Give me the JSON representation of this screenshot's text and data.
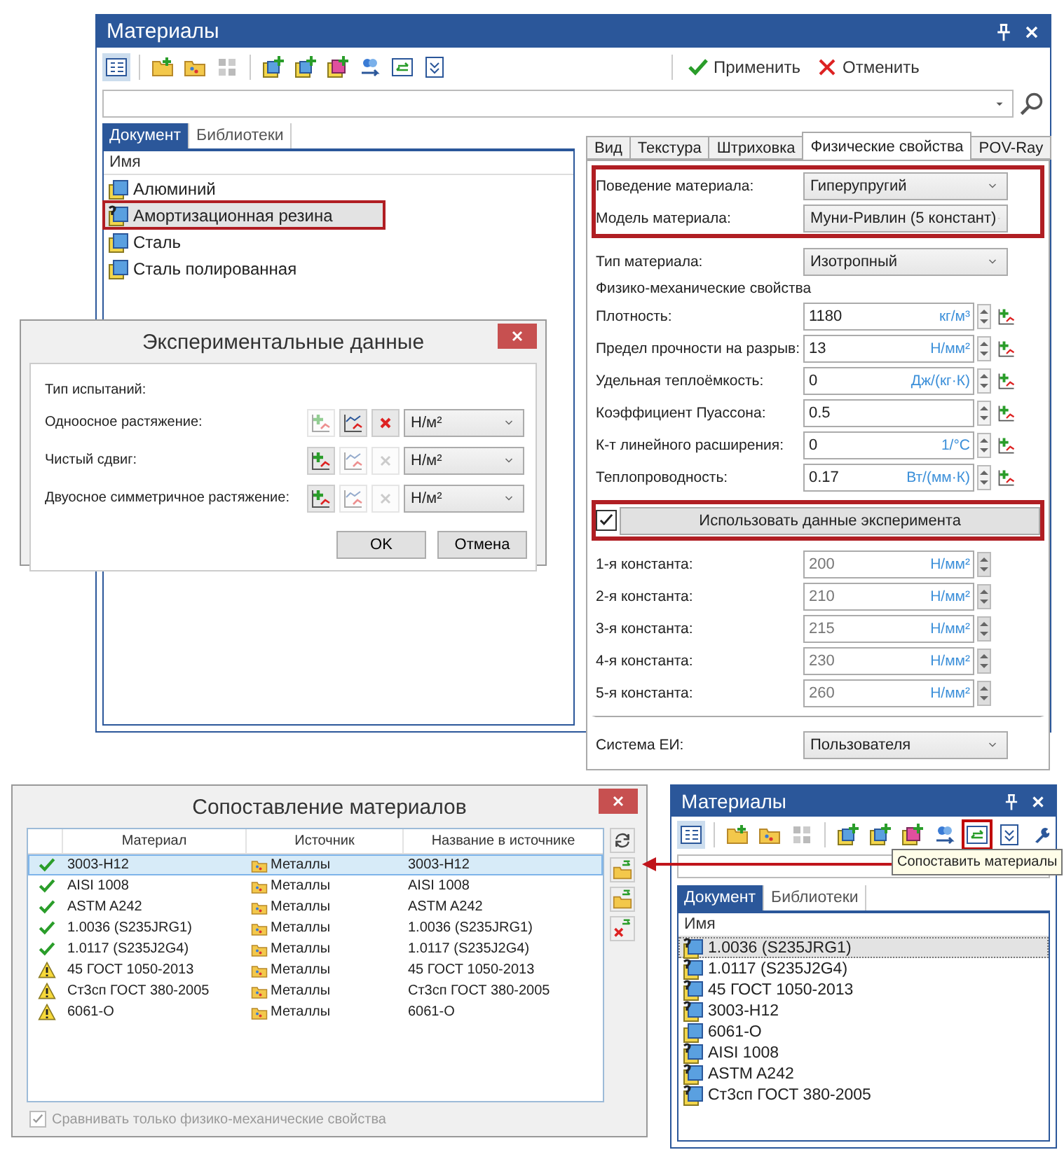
{
  "main_window": {
    "title": "Материалы",
    "apply": "Применить",
    "cancel": "Отменить",
    "library_tabs": [
      {
        "label": "Документ",
        "selected": true
      },
      {
        "label": "Библиотеки",
        "selected": false
      }
    ],
    "list_header": "Имя",
    "materials": [
      {
        "name": "Алюминий",
        "kind": "defined",
        "selected": false,
        "highlighted": false
      },
      {
        "name": "Амортизационная резина",
        "kind": "undefined",
        "selected": true,
        "highlighted": true
      },
      {
        "name": "Сталь",
        "kind": "defined",
        "selected": false,
        "highlighted": false
      },
      {
        "name": "Сталь полированная",
        "kind": "defined",
        "selected": false,
        "highlighted": false
      }
    ],
    "property_tabs": [
      {
        "label": "Вид",
        "selected": false
      },
      {
        "label": "Текстура",
        "selected": false
      },
      {
        "label": "Штриховка",
        "selected": false
      },
      {
        "label": "Физические свойства",
        "selected": true
      },
      {
        "label": "POV-Ray",
        "selected": false
      }
    ],
    "property_sections": [
      {
        "highlighted": true,
        "divided": false,
        "rows": [
          {
            "kind": "select",
            "label": "Поведение материала:",
            "value": "Гиперупругий"
          },
          {
            "kind": "select",
            "label": "Модель материала:",
            "value": "Муни-Ривлин (5 констант)"
          }
        ]
      },
      {
        "highlighted": false,
        "divided": false,
        "rows": [
          {
            "kind": "select",
            "label": "Тип материала:",
            "value": "Изотропный"
          },
          {
            "kind": "heading",
            "label": "Физико-механические свойства"
          },
          {
            "kind": "number",
            "label": "Плотность:",
            "value": "1180",
            "unit": "кг/м³"
          },
          {
            "kind": "number",
            "label": "Предел прочности на разрыв:",
            "value": "13",
            "unit": "Н/мм²"
          },
          {
            "kind": "number",
            "label": "Удельная теплоёмкость:",
            "value": "0",
            "unit": "Дж/(кг·К)"
          },
          {
            "kind": "number",
            "label": "Коэффициент Пуассона:",
            "value": "0.5"
          },
          {
            "kind": "number",
            "label": "К-т линейного расширения:",
            "value": "0",
            "unit": "1/°C"
          },
          {
            "kind": "number",
            "label": "Теплопроводность:",
            "value": "0.17",
            "unit": "Вт/(мм·К)"
          }
        ]
      },
      {
        "highlighted": true,
        "divided": false,
        "rows": [
          {
            "kind": "checkbox_button",
            "label": "Использовать данные эксперимента",
            "checked": true
          }
        ]
      },
      {
        "highlighted": false,
        "divided": false,
        "rows": [
          {
            "kind": "constant",
            "label": "1-я константа:",
            "value": "200",
            "unit": "Н/мм²"
          },
          {
            "kind": "constant",
            "label": "2-я константа:",
            "value": "210",
            "unit": "Н/мм²"
          },
          {
            "kind": "constant",
            "label": "3-я константа:",
            "value": "215",
            "unit": "Н/мм²"
          },
          {
            "kind": "constant",
            "label": "4-я константа:",
            "value": "230",
            "unit": "Н/мм²"
          },
          {
            "kind": "constant",
            "label": "5-я константа:",
            "value": "260",
            "unit": "Н/мм²"
          }
        ]
      },
      {
        "highlighted": false,
        "divided": true,
        "rows": [
          {
            "kind": "select",
            "label": "Система ЕИ:",
            "value": "Пользователя"
          }
        ]
      }
    ]
  },
  "experiment_dialog": {
    "title": "Экспериментальные данные",
    "subtitle": "Тип испытаний:",
    "tests": [
      {
        "label": "Одноосное растяжение:",
        "has_data": true,
        "unit": "Н/м²"
      },
      {
        "label": "Чистый сдвиг:",
        "has_data": false,
        "unit": "Н/м²"
      },
      {
        "label": "Двуосное симметричное растяжение:",
        "has_data": false,
        "unit": "Н/м²"
      }
    ],
    "buttons": [
      "OK",
      "Отмена"
    ]
  },
  "compare_dialog": {
    "title": "Сопоставление материалов",
    "columns": [
      "Материал",
      "Источник",
      "Название в источнике"
    ],
    "rows": [
      {
        "kind": "ok",
        "material": "3003-H12",
        "source": "Металлы",
        "source_name": "3003-H12",
        "selected": true
      },
      {
        "kind": "ok",
        "material": "AISI 1008",
        "source": "Металлы",
        "source_name": "AISI 1008",
        "selected": false
      },
      {
        "kind": "ok",
        "material": "ASTM A242",
        "source": "Металлы",
        "source_name": "ASTM A242",
        "selected": false
      },
      {
        "kind": "ok",
        "material": "1.0036 (S235JRG1)",
        "source": "Металлы",
        "source_name": "1.0036 (S235JRG1)",
        "selected": false
      },
      {
        "kind": "ok",
        "material": "1.0117 (S235J2G4)",
        "source": "Металлы",
        "source_name": "1.0117 (S235J2G4)",
        "selected": false
      },
      {
        "kind": "warning",
        "material": "45 ГОСТ 1050-2013",
        "source": "Металлы",
        "source_name": "45 ГОСТ 1050-2013",
        "selected": false
      },
      {
        "kind": "warning",
        "material": "Ст3сп ГОСТ 380-2005",
        "source": "Металлы",
        "source_name": "Ст3сп ГОСТ 380-2005",
        "selected": false
      },
      {
        "kind": "warning",
        "material": "6061-O",
        "source": "Металлы",
        "source_name": "6061-O",
        "selected": false
      }
    ],
    "footer": {
      "label": "Сравнивать только физико-механические свойства",
      "checked": true
    }
  },
  "small_window": {
    "title": "Материалы",
    "tooltip": "Сопоставить материалы",
    "library_tabs": [
      {
        "label": "Документ",
        "selected": true
      },
      {
        "label": "Библиотеки",
        "selected": false
      }
    ],
    "list_header": "Имя",
    "materials": [
      {
        "name": "1.0036 (S235JRG1)",
        "kind": "undefined",
        "selected": true
      },
      {
        "name": "1.0117 (S235J2G4)",
        "kind": "undefined",
        "selected": false
      },
      {
        "name": "45 ГОСТ 1050-2013",
        "kind": "undefined",
        "selected": false
      },
      {
        "name": "3003-H12",
        "kind": "undefined",
        "selected": false
      },
      {
        "name": "6061-O",
        "kind": "defined",
        "selected": false
      },
      {
        "name": "AISI 1008",
        "kind": "undefined",
        "selected": false
      },
      {
        "name": "ASTM A242",
        "kind": "undefined",
        "selected": false
      },
      {
        "name": "Ст3сп ГОСТ 380-2005",
        "kind": "undefined",
        "selected": false
      }
    ]
  }
}
